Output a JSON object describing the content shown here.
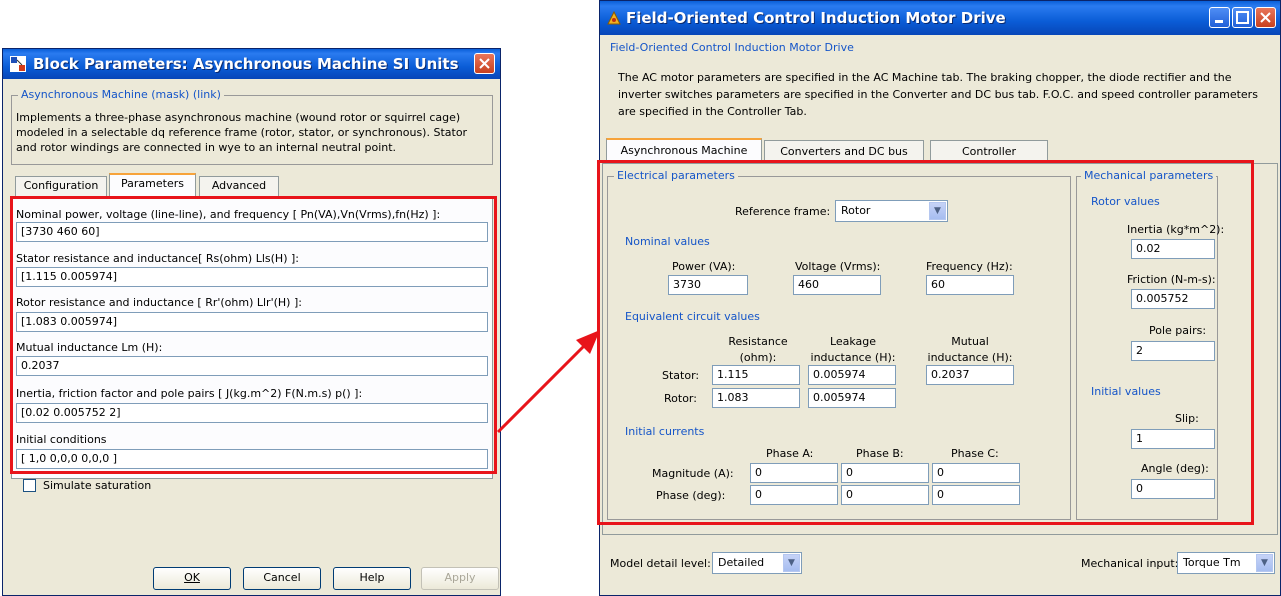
{
  "left_dialog": {
    "title": "Block Parameters: Asynchronous Machine SI Units",
    "group_title": "Asynchronous Machine (mask) (link)",
    "description": "Implements a three-phase asynchronous machine (wound rotor or squirrel cage) modeled in a selectable  dq reference frame (rotor, stator, or synchronous). Stator and rotor windings are connected in wye to an internal neutral point.",
    "tabs": [
      "Configuration",
      "Parameters",
      "Advanced"
    ],
    "active_tab": "Parameters",
    "params": [
      {
        "label": "Nominal power, voltage (line-line), and frequency [ Pn(VA),Vn(Vrms),fn(Hz) ]:",
        "value": "[3730 460 60]"
      },
      {
        "label": "Stator resistance and inductance[ Rs(ohm)  Lls(H) ]:",
        "value": "[1.115 0.005974]"
      },
      {
        "label": "Rotor resistance and inductance [ Rr'(ohm)  Llr'(H) ]:",
        "value": "[1.083 0.005974]"
      },
      {
        "label": "Mutual inductance Lm (H):",
        "value": "0.2037"
      },
      {
        "label": "Inertia, friction factor and pole pairs [ J(kg.m^2)  F(N.m.s)  p() ]:",
        "value": "[0.02 0.005752 2]"
      },
      {
        "label": "Initial conditions",
        "value": "[ 1,0   0,0,0   0,0,0 ]"
      }
    ],
    "checkbox_label": "Simulate saturation",
    "buttons": {
      "ok": "OK",
      "cancel": "Cancel",
      "help": "Help",
      "apply": "Apply"
    }
  },
  "right_dialog": {
    "title": "Field-Oriented Control Induction Motor Drive",
    "subtitle": "Field-Oriented Control Induction Motor Drive",
    "description": "The AC motor parameters are specified in the AC Machine tab. The braking chopper, the diode rectifier and the inverter switches parameters are specified in the Converter and DC bus tab. F.O.C. and speed controller parameters are specified in the Controller Tab.",
    "tabs": [
      "Asynchronous Machine",
      "Converters and DC bus",
      "Controller"
    ],
    "active_tab": "Asynchronous Machine",
    "electrical": {
      "title": "Electrical parameters",
      "ref_frame_label": "Reference frame:",
      "ref_frame_value": "Rotor",
      "nominal_title": "Nominal values",
      "power_label": "Power (VA):",
      "power_value": "3730",
      "voltage_label": "Voltage (Vrms):",
      "voltage_value": "460",
      "freq_label": "Frequency (Hz):",
      "freq_value": "60",
      "equiv_title": "Equivalent circuit values",
      "resistance_label_1": "Resistance",
      "resistance_label_2": "(ohm):",
      "leakage_label_1": "Leakage",
      "leakage_label_2": "inductance (H):",
      "mutual_label_1": "Mutual",
      "mutual_label_2": "inductance (H):",
      "stator_label": "Stator:",
      "stator_r": "1.115",
      "stator_l": "0.005974",
      "mutual_value": "0.2037",
      "rotor_label": "Rotor:",
      "rotor_r": "1.083",
      "rotor_l": "0.005974",
      "currents_title": "Initial currents",
      "phase_a": "Phase A:",
      "phase_b": "Phase B:",
      "phase_c": "Phase C:",
      "magnitude_label": "Magnitude (A):",
      "phase_label": "Phase (deg):",
      "mag_a": "0",
      "mag_b": "0",
      "mag_c": "0",
      "ph_a": "0",
      "ph_b": "0",
      "ph_c": "0"
    },
    "mechanical": {
      "title": "Mechanical parameters",
      "rotor_values_title": "Rotor values",
      "inertia_label": "Inertia (kg*m^2):",
      "inertia_value": "0.02",
      "friction_label": "Friction (N-m-s):",
      "friction_value": "0.005752",
      "pole_label": "Pole pairs:",
      "pole_value": "2",
      "initial_title": "Initial values",
      "slip_label": "Slip:",
      "slip_value": "1",
      "angle_label": "Angle (deg):",
      "angle_value": "0"
    },
    "model_detail_label": "Model detail level:",
    "model_detail_value": "Detailed",
    "mech_input_label": "Mechanical input:",
    "mech_input_value": "Torque Tm"
  },
  "colors": {
    "highlight": "#e8141a",
    "titlebar": "#0a5cd6",
    "group_label": "#1555c8"
  }
}
